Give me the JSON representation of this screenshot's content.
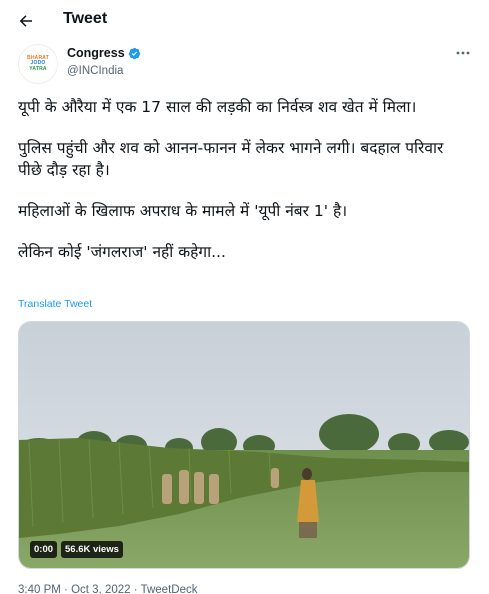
{
  "header": {
    "title": "Tweet",
    "back_icon": "arrow-left-icon"
  },
  "author": {
    "display_name": "Congress",
    "handle": "@INCIndia",
    "verified_icon": "verified-badge-icon",
    "verified_color": "#1d9bf0",
    "avatar_lines": [
      "BHARAT",
      "JODO",
      "YATRA"
    ],
    "avatar_colors": [
      "#f07a1a",
      "#1d7ed6",
      "#1a9b3f"
    ],
    "more_icon": "more-options-icon"
  },
  "tweet": {
    "paragraphs": [
      "यूपी के औरैया में एक 17 साल की लड़की का निर्वस्त्र शव खेत में मिला।",
      "पुलिस पहुंची और शव को आनन-फानन में लेकर भागने लगी। बदहाल परिवार पीछे दौड़ रहा है।",
      "महिलाओं के खिलाफ अपराध के मामले में 'यूपी नंबर 1' है।",
      "लेकिन कोई 'जंगलराज' नहीं कहेगा..."
    ],
    "translate_label": "Translate Tweet",
    "link_color": "#1d9bf0"
  },
  "media": {
    "duration": "0:00",
    "views": "56.6K views"
  },
  "meta": {
    "time": "3:40 PM",
    "separator": "·",
    "date": "Oct 3, 2022",
    "source": "TweetDeck"
  }
}
